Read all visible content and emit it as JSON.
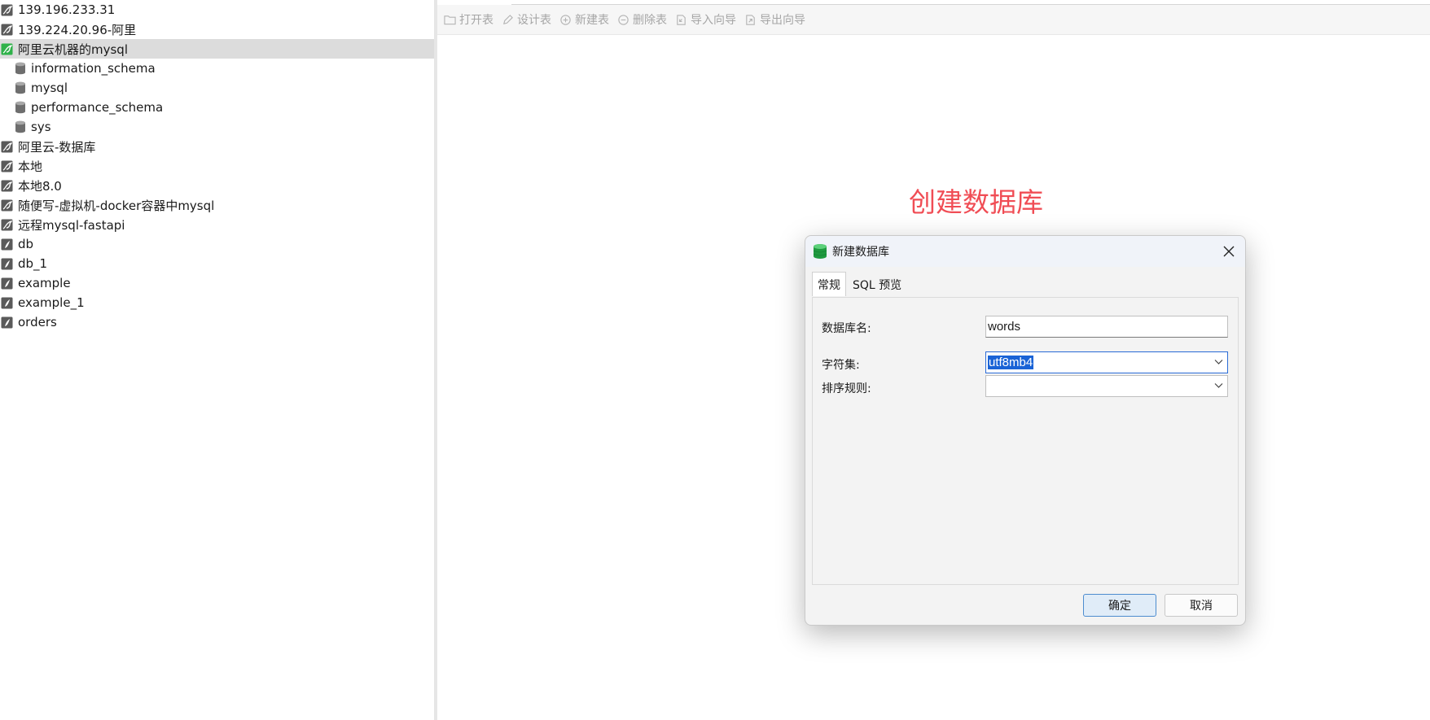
{
  "tree": {
    "connections_top": [
      {
        "label": "139.196.233.31",
        "icon": "mysql-connection-icon"
      },
      {
        "label": "139.224.20.96-阿里",
        "icon": "mysql-connection-icon"
      },
      {
        "label": "阿里云机器的mysql",
        "icon": "mysql-connection-open-icon",
        "selected": true
      }
    ],
    "databases": [
      {
        "label": "information_schema",
        "icon": "database-icon"
      },
      {
        "label": "mysql",
        "icon": "database-icon"
      },
      {
        "label": "performance_schema",
        "icon": "database-icon"
      },
      {
        "label": "sys",
        "icon": "database-icon"
      }
    ],
    "connections_rest": [
      {
        "label": "阿里云-数据库",
        "icon": "mysql-connection-icon"
      },
      {
        "label": "本地",
        "icon": "mysql-connection-icon"
      },
      {
        "label": "本地8.0",
        "icon": "mysql-connection-icon"
      },
      {
        "label": "随便写-虚拟机-docker容器中mysql",
        "icon": "mysql-connection-icon"
      },
      {
        "label": "远程mysql-fastapi",
        "icon": "mysql-connection-icon"
      },
      {
        "label": "db",
        "icon": "sqlite-connection-icon"
      },
      {
        "label": "db_1",
        "icon": "sqlite-connection-icon"
      },
      {
        "label": "example",
        "icon": "sqlite-connection-icon"
      },
      {
        "label": "example_1",
        "icon": "sqlite-connection-icon"
      },
      {
        "label": "orders",
        "icon": "sqlite-connection-icon"
      }
    ]
  },
  "toolbar": {
    "open_table": "打开表",
    "design_table": "设计表",
    "new_table": "新建表",
    "delete_table": "删除表",
    "import_wizard": "导入向导",
    "export_wizard": "导出向导"
  },
  "annotation": {
    "text": "创建数据库",
    "color": "#f04d55"
  },
  "dialog": {
    "title": "新建数据库",
    "tabs": [
      "常规",
      "SQL 预览"
    ],
    "active_tab": "常规",
    "fields": {
      "db_name_label": "数据库名:",
      "db_name_value": "words",
      "charset_label": "字符集:",
      "charset_value": "utf8mb4",
      "collation_label": "排序规则:",
      "collation_value": ""
    },
    "ok_label": "确定",
    "cancel_label": "取消"
  }
}
